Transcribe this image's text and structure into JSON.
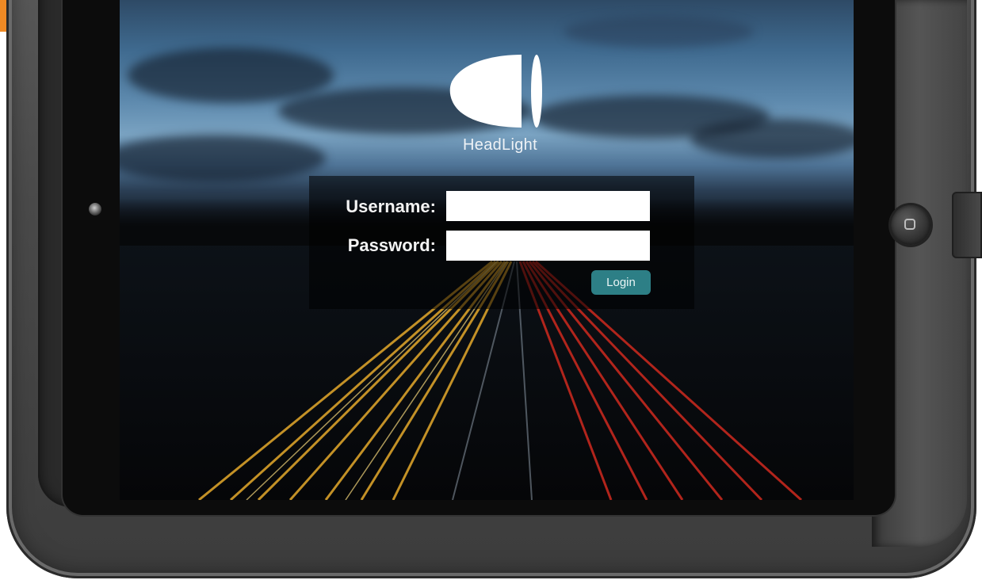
{
  "app": {
    "brand_name": "HeadLight",
    "logo_icon": "headlight-logo-icon"
  },
  "login_form": {
    "username_label": "Username:",
    "username_value": "",
    "password_label": "Password:",
    "password_value": "",
    "login_button_label": "Login"
  },
  "device": {
    "home_button_icon": "home-button-icon",
    "camera_icon": "front-camera-icon"
  },
  "colors": {
    "accent_button": "#2d7f86",
    "case": "#4a4a4a",
    "orange_tab": "#f08a24"
  }
}
